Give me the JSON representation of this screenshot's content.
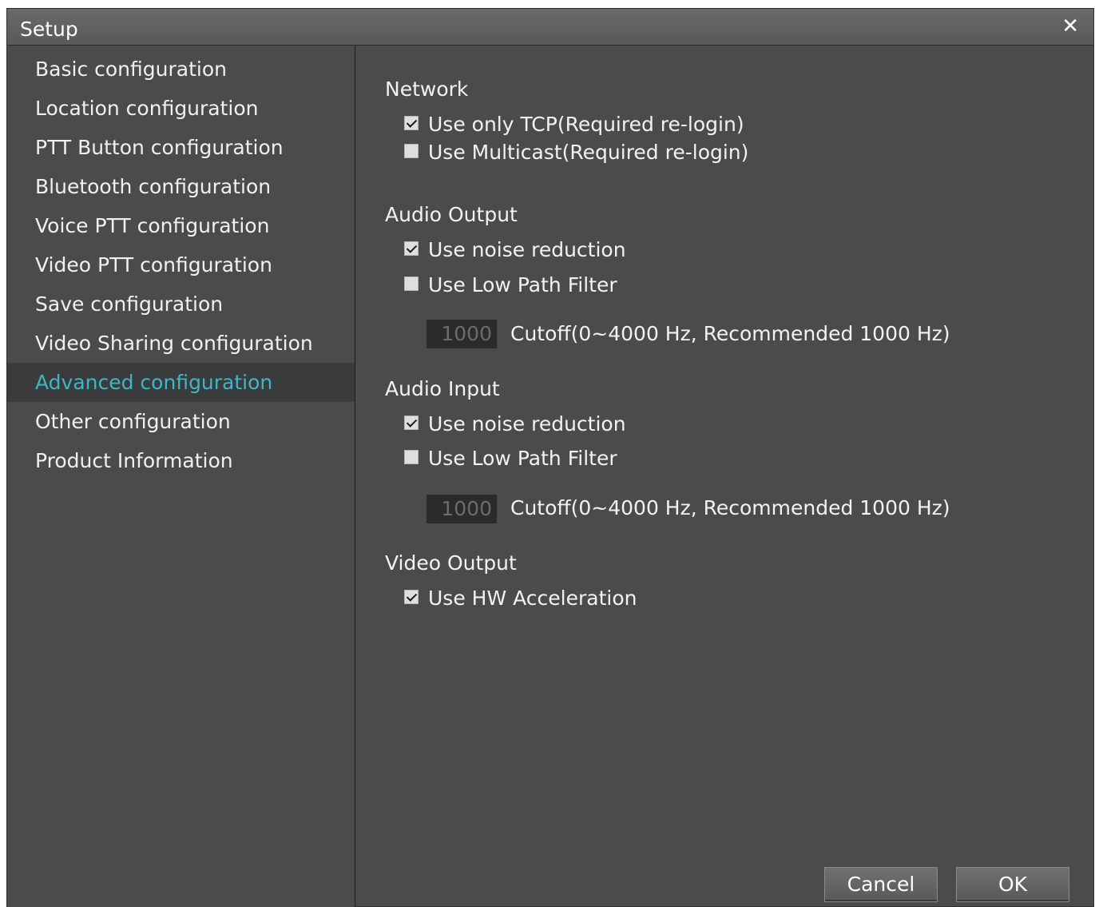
{
  "window": {
    "title": "Setup",
    "close_glyph": "✕"
  },
  "sidebar": {
    "items": [
      {
        "label": "Basic configuration",
        "active": false
      },
      {
        "label": "Location configuration",
        "active": false
      },
      {
        "label": "PTT Button configuration",
        "active": false
      },
      {
        "label": "Bluetooth configuration",
        "active": false
      },
      {
        "label": "Voice PTT configuration",
        "active": false
      },
      {
        "label": "Video PTT configuration",
        "active": false
      },
      {
        "label": "Save configuration",
        "active": false
      },
      {
        "label": "Video Sharing configuration",
        "active": false
      },
      {
        "label": "Advanced configuration",
        "active": true
      },
      {
        "label": "Other configuration",
        "active": false
      },
      {
        "label": "Product Information",
        "active": false
      }
    ]
  },
  "network": {
    "title": "Network",
    "tcp": {
      "label": "Use only TCP(Required re-login)",
      "checked": true
    },
    "multicast": {
      "label": "Use Multicast(Required re-login)",
      "checked": false
    }
  },
  "audio_output": {
    "title": "Audio Output",
    "noise": {
      "label": "Use noise reduction",
      "checked": true
    },
    "lpf": {
      "label": "Use Low Path Filter",
      "checked": false
    },
    "cutoff_value": "1000",
    "cutoff_label": "Cutoff(0~4000 Hz, Recommended 1000 Hz)"
  },
  "audio_input": {
    "title": "Audio Input",
    "noise": {
      "label": "Use noise reduction",
      "checked": true
    },
    "lpf": {
      "label": "Use Low Path Filter",
      "checked": false
    },
    "cutoff_value": "1000",
    "cutoff_label": "Cutoff(0~4000 Hz, Recommended 1000 Hz)"
  },
  "video_output": {
    "title": "Video Output",
    "hw": {
      "label": "Use HW Acceleration",
      "checked": true
    }
  },
  "buttons": {
    "cancel": "Cancel",
    "ok": "OK"
  },
  "colors": {
    "background": "#4a4b4d",
    "active_item_bg": "#3a3b3d",
    "accent": "#3fb6c4"
  },
  "icons": {
    "close": "close-icon",
    "checkbox_checked": "checkbox-checked-icon",
    "checkbox_unchecked": "checkbox-unchecked-icon"
  }
}
